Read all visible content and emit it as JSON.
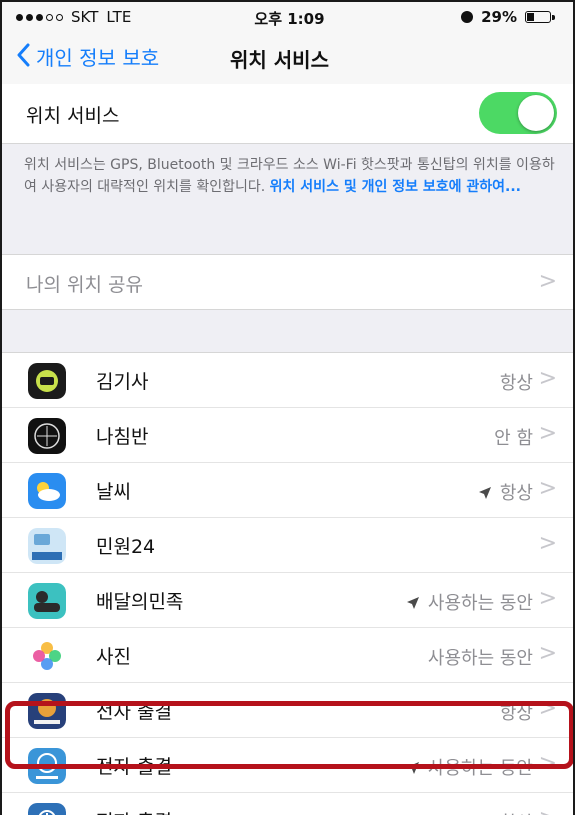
{
  "status_bar": {
    "carrier": "SKT",
    "network": "LTE",
    "time": "오후 1:09",
    "battery": "29%"
  },
  "nav": {
    "back_label": "개인 정보 보호",
    "title": "위치 서비스"
  },
  "location_services": {
    "label": "위치 서비스",
    "enabled": true
  },
  "description": {
    "text": "위치 서비스는 GPS, Bluetooth 및 크라우드 소스 Wi-Fi 핫스팟과 통신탑의 위치를 이용하여 사용자의 대략적인 위치를 확인합니다. ",
    "link": "위치 서비스 및 개인 정보 보호에 관하여..."
  },
  "share_location": {
    "label": "나의 위치 공유",
    "chevron": ">"
  },
  "apps": [
    {
      "name": "김기사",
      "status": "항상",
      "arrow": false,
      "icon": "kimgisa-icon"
    },
    {
      "name": "나침반",
      "status": "안 함",
      "arrow": false,
      "icon": "compass-icon"
    },
    {
      "name": "날씨",
      "status": "항상",
      "arrow": true,
      "icon": "weather-icon"
    },
    {
      "name": "민원24",
      "status": "",
      "arrow": false,
      "icon": "minwon24-icon"
    },
    {
      "name": "배달의민족",
      "status": "사용하는 동안",
      "arrow": true,
      "icon": "baemin-icon"
    },
    {
      "name": "사진",
      "status": "사용하는 동안",
      "arrow": false,
      "icon": "photos-icon"
    },
    {
      "name": "전자 출결",
      "status": "항상",
      "arrow": false,
      "icon": "attendance-icon"
    },
    {
      "name": "전자 출결",
      "status": "사용하는 동안",
      "arrow": true,
      "icon": "attendance-blue-icon"
    },
    {
      "name": "전자 출결",
      "status": "항상",
      "arrow": false,
      "icon": "attendance-alt-icon"
    }
  ],
  "colors": {
    "accent": "#157efb",
    "toggle_on": "#4cd964",
    "highlight": "#b5121b"
  }
}
